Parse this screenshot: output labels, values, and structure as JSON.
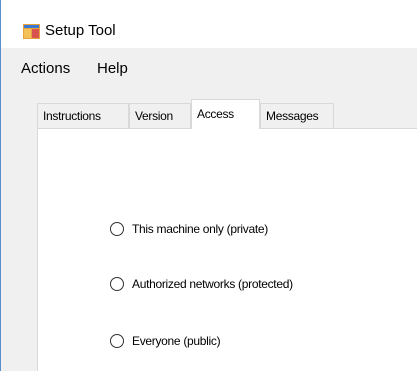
{
  "window": {
    "title": "Setup Tool",
    "icon": "app-window-icon"
  },
  "menu": {
    "items": [
      "Actions",
      "Help"
    ]
  },
  "tabs": {
    "items": [
      "Instructions",
      "Version",
      "Access",
      "Messages"
    ],
    "selected": "Access"
  },
  "access": {
    "options": [
      {
        "label": "This machine only (private)",
        "checked": false
      },
      {
        "label": "Authorized networks (protected)",
        "checked": false
      },
      {
        "label": "Everyone (public)",
        "checked": false
      }
    ]
  },
  "colors": {
    "window_border": "#5b8ecf",
    "chrome_bg": "#f0f0f0",
    "page_bg": "#ffffff"
  }
}
